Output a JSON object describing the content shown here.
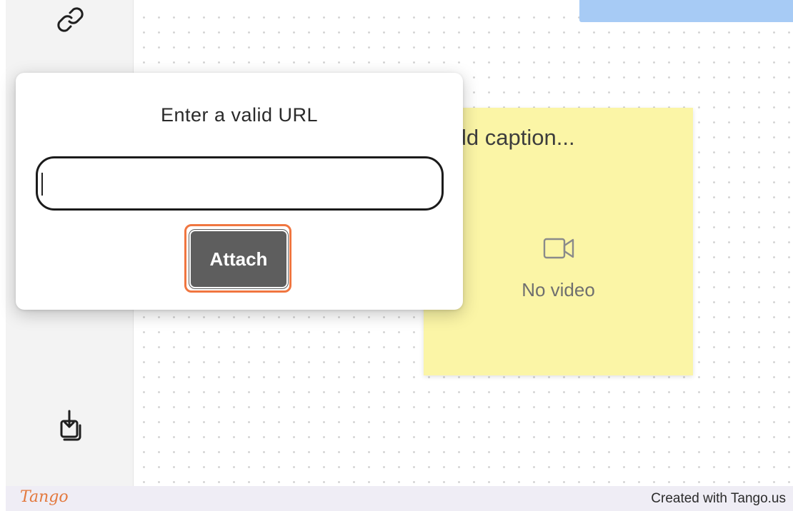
{
  "sidebar": {
    "icons": [
      "link-icon",
      "import-icon"
    ]
  },
  "canvas": {
    "sticky_note": {
      "caption": "Add caption...",
      "empty_state": "No video",
      "icon": "video-camera-icon",
      "color": "#fbf5a6"
    },
    "blue_note_color": "#a7cbf5"
  },
  "popup": {
    "title": "Enter a valid URL",
    "input_value": "",
    "attach_label": "Attach",
    "highlight_color": "#f07640"
  },
  "footer": {
    "logo": "Tango",
    "credit": "Created with Tango.us"
  }
}
